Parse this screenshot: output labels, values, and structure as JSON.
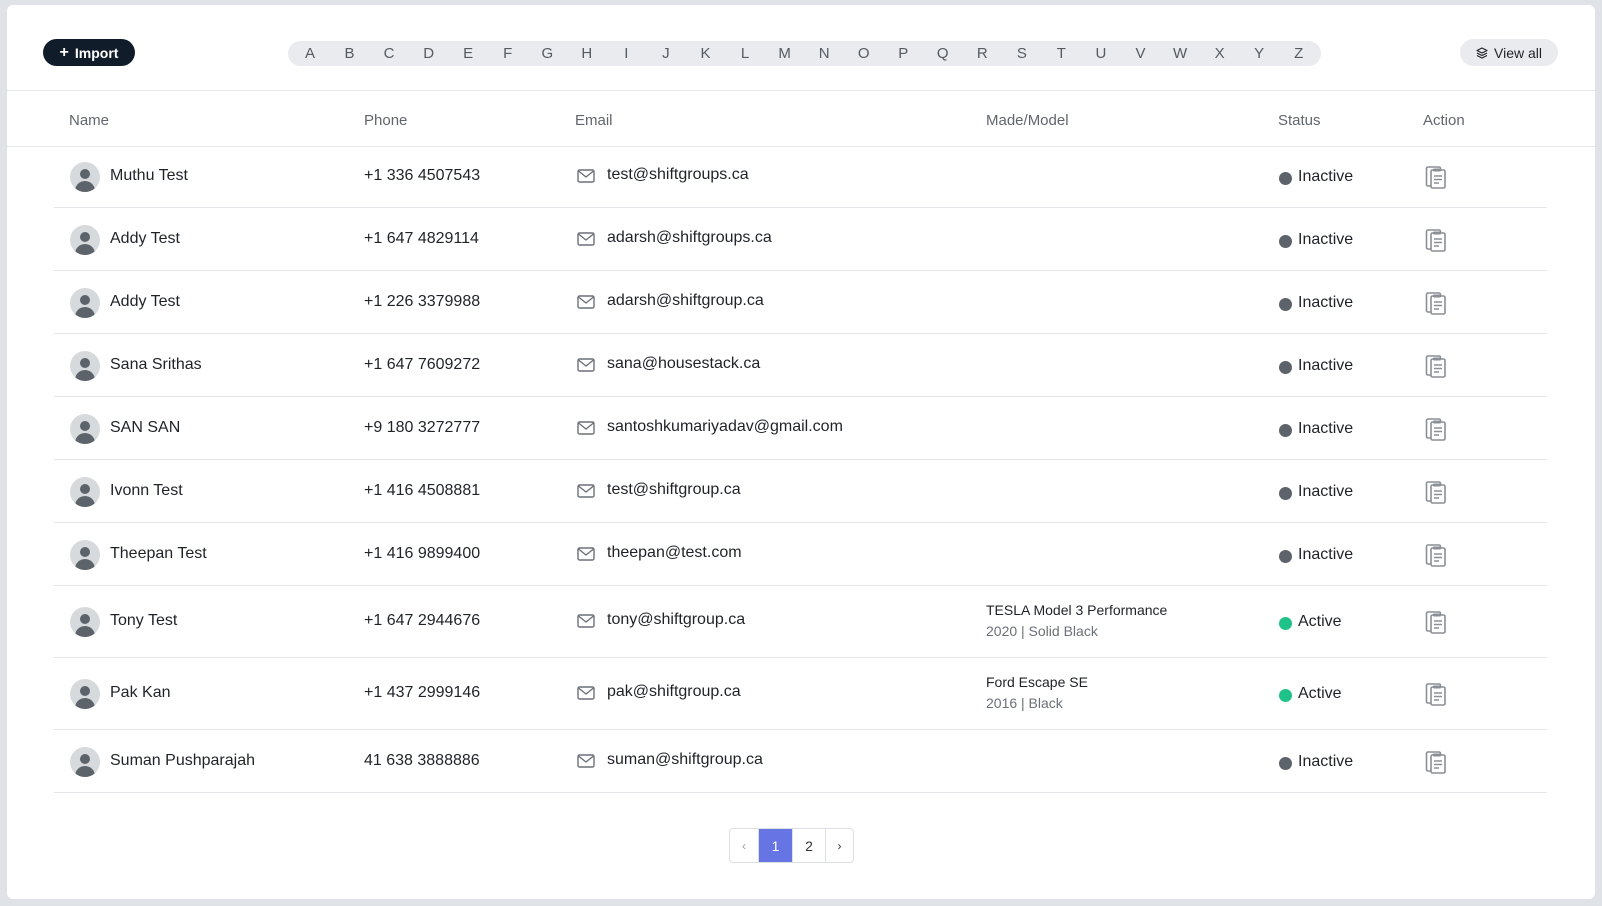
{
  "toolbar": {
    "import_label": "Import",
    "view_all_label": "View all",
    "letters": [
      "A",
      "B",
      "C",
      "D",
      "E",
      "F",
      "G",
      "H",
      "I",
      "J",
      "K",
      "L",
      "M",
      "N",
      "O",
      "P",
      "Q",
      "R",
      "S",
      "T",
      "U",
      "V",
      "W",
      "X",
      "Y",
      "Z"
    ]
  },
  "columns": {
    "name": "Name",
    "phone": "Phone",
    "email": "Email",
    "model": "Made/Model",
    "status": "Status",
    "action": "Action"
  },
  "colors": {
    "inactive": "#5d636a",
    "active": "#1fc38a",
    "accent": "#6675e3",
    "import_bg": "#111c2b"
  },
  "rows": [
    {
      "name": "Muthu Test",
      "phone": "+1 336 4507543",
      "email": "test@shiftgroups.ca",
      "model_name": "",
      "model_sub": "",
      "status": "Inactive"
    },
    {
      "name": "Addy Test",
      "phone": "+1 647 4829114",
      "email": "adarsh@shiftgroups.ca",
      "model_name": "",
      "model_sub": "",
      "status": "Inactive"
    },
    {
      "name": "Addy Test",
      "phone": "+1 226 3379988",
      "email": "adarsh@shiftgroup.ca",
      "model_name": "",
      "model_sub": "",
      "status": "Inactive"
    },
    {
      "name": "Sana Srithas",
      "phone": "+1 647 7609272",
      "email": "sana@housestack.ca",
      "model_name": "",
      "model_sub": "",
      "status": "Inactive"
    },
    {
      "name": "SAN SAN",
      "phone": "+9 180 3272777",
      "email": "santoshkumariyadav@gmail.com",
      "model_name": "",
      "model_sub": "",
      "status": "Inactive"
    },
    {
      "name": "Ivonn Test",
      "phone": "+1 416 4508881",
      "email": "test@shiftgroup.ca",
      "model_name": "",
      "model_sub": "",
      "status": "Inactive"
    },
    {
      "name": "Theepan Test",
      "phone": "+1 416 9899400",
      "email": "theepan@test.com",
      "model_name": "",
      "model_sub": "",
      "status": "Inactive"
    },
    {
      "name": "Tony Test",
      "phone": "+1 647 2944676",
      "email": "tony@shiftgroup.ca",
      "model_name": "TESLA Model 3 Performance",
      "model_sub": "2020 |  Solid Black",
      "status": "Active"
    },
    {
      "name": "Pak Kan",
      "phone": "+1 437 2999146",
      "email": "pak@shiftgroup.ca",
      "model_name": "Ford Escape SE",
      "model_sub": "2016 |  Black",
      "status": "Active"
    },
    {
      "name": "Suman Pushparajah",
      "phone": "41 638 3888886",
      "email": "suman@shiftgroup.ca",
      "model_name": "",
      "model_sub": "",
      "status": "Inactive"
    }
  ],
  "pagination": {
    "prev": "‹",
    "pages": [
      "1",
      "2"
    ],
    "current": "1",
    "next": "›"
  }
}
